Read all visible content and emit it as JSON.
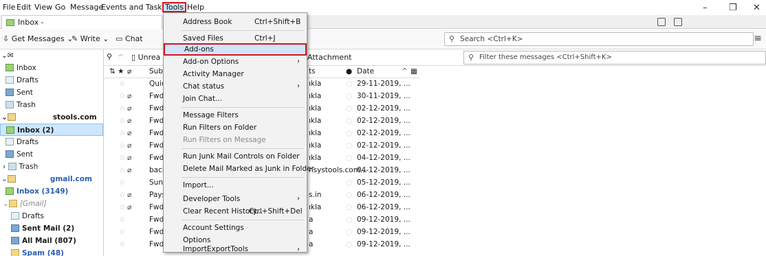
{
  "menubar": {
    "items": [
      "File",
      "Edit",
      "View",
      "Go",
      "Message",
      "Events and Tasks",
      "Tools",
      "Help"
    ]
  },
  "tabs": {
    "inbox_label": "Inbox -"
  },
  "toolbar": {
    "get_messages": "Get Messages",
    "write": "Write",
    "chat": "Chat",
    "search_placeholder": "Search <Ctrl+K>"
  },
  "quickfilter": {
    "unread": "Unrea",
    "attachment": "Attachment",
    "filter_placeholder": "Filter these messages <Ctrl+Shift+K>"
  },
  "columns": {
    "subject": "Subje",
    "correspondents": "ts",
    "date": "Date"
  },
  "folders": [
    {
      "label": "Inbox",
      "icon": "inbox-icon"
    },
    {
      "label": "Drafts",
      "icon": "drafts-icon"
    },
    {
      "label": "Sent",
      "icon": "sent-icon"
    },
    {
      "label": "Trash",
      "icon": "trash-icon"
    },
    {
      "label": "stools.com",
      "icon": "account-icon"
    },
    {
      "label": "Inbox (2)",
      "icon": "inbox-icon"
    },
    {
      "label": "Drafts",
      "icon": "drafts-icon"
    },
    {
      "label": "Sent",
      "icon": "sent-icon"
    },
    {
      "label": "Trash",
      "icon": "trash-icon"
    },
    {
      "label": "gmail.com",
      "icon": "account-icon"
    },
    {
      "label": "Inbox (3149)",
      "icon": "inbox-icon"
    },
    {
      "label": "[Gmail]",
      "icon": "folder-icon"
    },
    {
      "label": "Drafts",
      "icon": "drafts-icon"
    },
    {
      "label": "Sent Mail (2)",
      "icon": "sent-icon"
    },
    {
      "label": "All Mail (807)",
      "icon": "allmail-icon"
    },
    {
      "label": "Spam (48)",
      "icon": "spam-icon"
    }
  ],
  "messages": [
    {
      "subject": "Quic",
      "sender": "ıkla",
      "date": "29-11-2019, ...",
      "att": ""
    },
    {
      "subject": "Fwd:",
      "sender": "ıkla",
      "date": "30-11-2019, ...",
      "att": "⌀"
    },
    {
      "subject": "Fwd:",
      "sender": "ıkla",
      "date": "02-12-2019, ...",
      "att": "⌀"
    },
    {
      "subject": "Fwd:",
      "sender": "ıkla",
      "date": "02-12-2019, ...",
      "att": "⌀"
    },
    {
      "subject": "Fwd:",
      "sender": "ıkla",
      "date": "02-12-2019, ...",
      "att": "⌀"
    },
    {
      "subject": "Fwd:",
      "sender": "ıkla",
      "date": "02-12-2019, ...",
      "att": "⌀"
    },
    {
      "subject": "Fwd:",
      "sender": "ıkla",
      "date": "04-12-2019, ...",
      "att": "⌀"
    },
    {
      "subject": "back",
      "sender": "nsystools.com...",
      "date": "04-12-2019, ...",
      "att": "⌀"
    },
    {
      "subject": "Sunc",
      "sender": "",
      "date": "05-12-2019, ...",
      "att": ""
    },
    {
      "subject": "Pays",
      "sender": "s.in",
      "date": "06-12-2019, ...",
      "att": "⌀"
    },
    {
      "subject": "Fwd:",
      "sender": "ıkla",
      "date": "06-12-2019, ...",
      "att": "⌀"
    },
    {
      "subject": "Fwd:",
      "sender": "a",
      "date": "09-12-2019, ...",
      "att": ""
    },
    {
      "subject": "Fwd:",
      "sender": "a",
      "date": "09-12-2019, ...",
      "att": ""
    },
    {
      "subject": "Fwd:",
      "sender": "a",
      "date": "09-12-2019, ...",
      "att": ""
    }
  ],
  "tools_menu": {
    "address_book": "Address Book",
    "address_book_sc": "Ctrl+Shift+B",
    "saved_files": "Saved Files",
    "saved_files_sc": "Ctrl+J",
    "addons": "Add-ons",
    "addon_options": "Add-on Options",
    "activity_manager": "Activity Manager",
    "chat_status": "Chat status",
    "join_chat": "Join Chat...",
    "message_filters": "Message Filters",
    "run_filters_folder": "Run Filters on Folder",
    "run_filters_message": "Run Filters on Message",
    "run_junk": "Run Junk Mail Controls on Folder",
    "delete_junk": "Delete Mail Marked as Junk in Folder",
    "import": "Import...",
    "developer_tools": "Developer Tools",
    "clear_history": "Clear Recent History...",
    "clear_history_sc": "Ctrl+Shift+Del",
    "account_settings": "Account Settings",
    "options": "Options",
    "importexport": "ImportExportTools"
  },
  "colors": {
    "highlight_border": "#d6141c",
    "selection": "#cfe5fb"
  }
}
